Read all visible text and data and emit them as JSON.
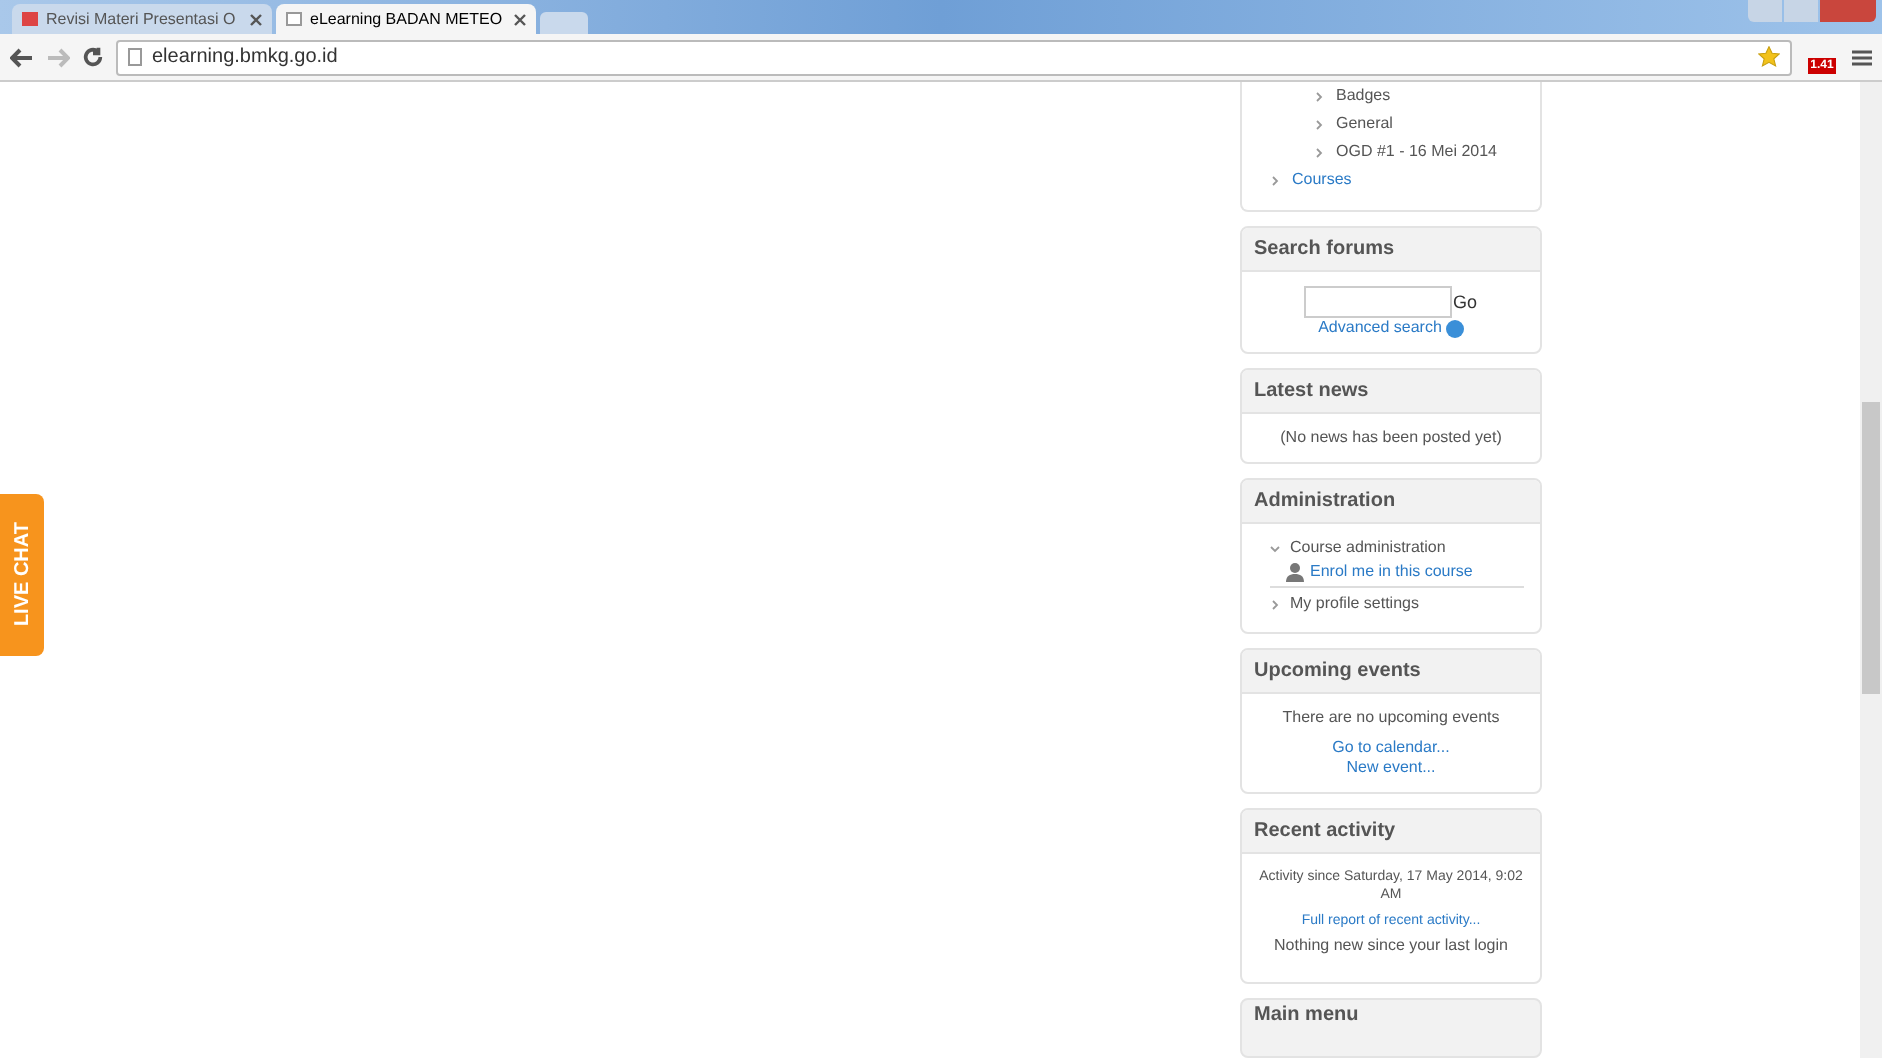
{
  "browser": {
    "tabs": [
      {
        "label": "Revisi Materi Presentasi O",
        "selected": false
      },
      {
        "label": "eLearning BADAN METEO",
        "selected": true
      }
    ],
    "address": "elearning.bmkg.go.id",
    "extension_badge": "1.41"
  },
  "live_chat": "LIVE CHAT",
  "navigation": {
    "items": [
      {
        "label": "Badges",
        "link": false
      },
      {
        "label": "General",
        "link": false
      },
      {
        "label": "OGD #1 - 16 Mei 2014",
        "link": false
      }
    ],
    "courses": "Courses"
  },
  "search_forums": {
    "title": "Search forums",
    "button": "Go",
    "advanced": "Advanced search"
  },
  "latest_news": {
    "title": "Latest news",
    "text": "(No news has been posted yet)"
  },
  "administration": {
    "title": "Administration",
    "items": [
      {
        "label": "Course administration",
        "expanded": true,
        "children": [
          {
            "label": "Enrol me in this course"
          }
        ]
      },
      {
        "label": "My profile settings",
        "expanded": false
      }
    ]
  },
  "upcoming_events": {
    "title": "Upcoming events",
    "text": "There are no upcoming events",
    "links": [
      "Go to calendar...",
      "New event..."
    ]
  },
  "recent_activity": {
    "title": "Recent activity",
    "since": "Activity since Saturday, 17 May 2014, 9:02 AM",
    "link": "Full report of recent activity...",
    "text": "Nothing new since your last login"
  },
  "main_menu": {
    "title": "Main menu"
  }
}
